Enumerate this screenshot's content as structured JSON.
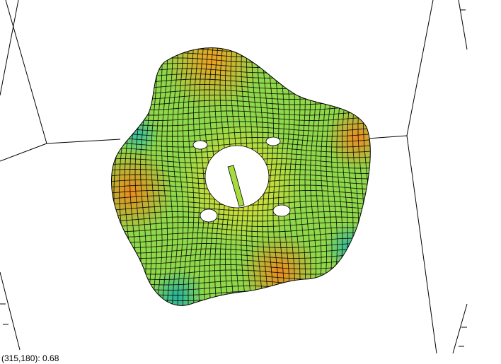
{
  "viewer": {
    "readout_pixel": "(315,180)",
    "readout_value": "0.68",
    "colormap": [
      "#1fb4a4",
      "#5fd27a",
      "#b8e84a",
      "#f2e12c",
      "#f5a623",
      "#e8761a"
    ]
  }
}
